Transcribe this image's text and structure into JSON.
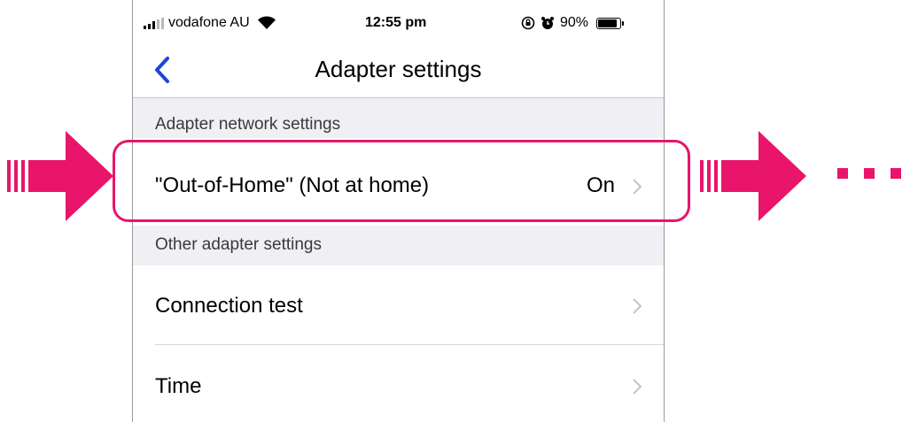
{
  "status_bar": {
    "carrier": "vodafone AU",
    "time": "12:55 pm",
    "battery": "90%",
    "battery_level": 0.9,
    "icons": [
      "signal-icon",
      "wifi-icon",
      "lock-rotation-icon",
      "alarm-icon",
      "battery-icon"
    ]
  },
  "nav": {
    "title": "Adapter settings",
    "back_icon": "chevron-left-icon"
  },
  "sections": {
    "network_header": "Adapter network settings",
    "other_header": "Other adapter settings"
  },
  "rows": {
    "out_of_home": {
      "label": "\"Out-of-Home\" (Not at home)",
      "value": "On"
    },
    "connection_test": {
      "label": "Connection test"
    },
    "time": {
      "label": "Time"
    }
  },
  "colors": {
    "accent": "#e8156b",
    "ios_blue": "#1b47d6",
    "section_bg": "#efeff4",
    "chevron": "#c4c4c7"
  }
}
